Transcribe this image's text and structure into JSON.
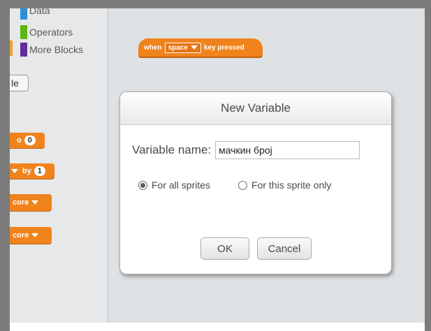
{
  "palette": {
    "categories": [
      {
        "label": "Data",
        "color": "#2f8fd6"
      },
      {
        "label": "Operators",
        "color": "#5cb712"
      },
      {
        "label": "More Blocks",
        "color": "#632d99"
      }
    ],
    "button_fragment": "le",
    "blocks": [
      {
        "fragment": "o",
        "value": "0"
      },
      {
        "fragment": "by",
        "value": "1"
      },
      {
        "fragment": "core"
      },
      {
        "fragment": "core"
      }
    ]
  },
  "script": {
    "hat_block": {
      "when": "when",
      "key": "space",
      "rest": "key pressed"
    }
  },
  "dialog": {
    "title": "New Variable",
    "field_label": "Variable name:",
    "field_value": "мачкин број",
    "radio_all": "For all sprites",
    "radio_this": "For this sprite only",
    "radio_selected": "all",
    "ok_label": "OK",
    "cancel_label": "Cancel"
  },
  "colors": {
    "block_orange": "#f0831c",
    "frame_gray": "#7b7b7b",
    "script_bg": "#dfe2e4"
  }
}
